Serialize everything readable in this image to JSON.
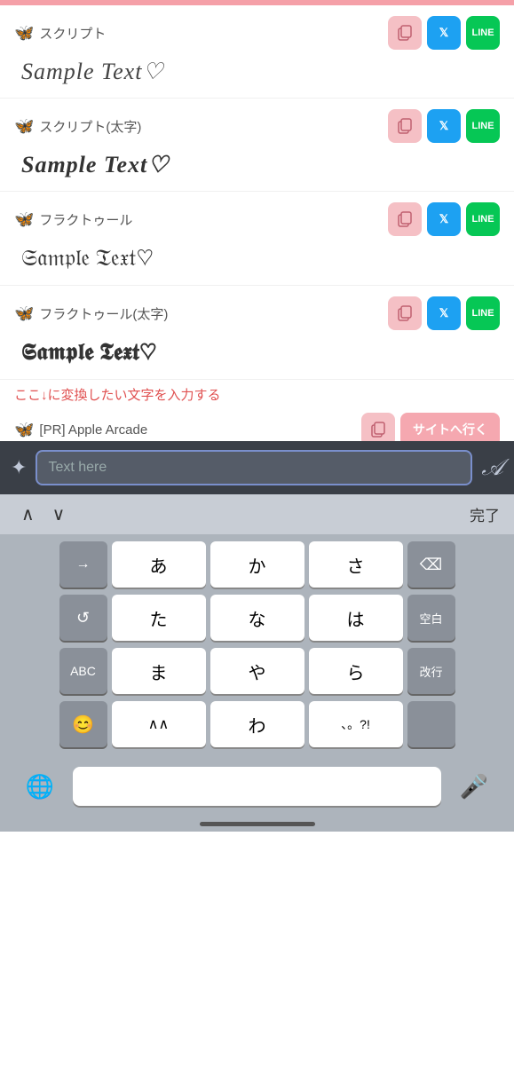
{
  "topBar": {},
  "sections": [
    {
      "id": "script",
      "label": "スクリプト",
      "sampleText": "Sample Text♡",
      "style": "script",
      "buttons": [
        "copy",
        "twitter",
        "line"
      ]
    },
    {
      "id": "script-bold",
      "label": "スクリプト(太字)",
      "sampleText": "Sample Text♡",
      "style": "script-bold",
      "buttons": [
        "copy",
        "twitter",
        "line"
      ]
    },
    {
      "id": "fraktur",
      "label": "フラクトゥール",
      "sampleText": "Sample Text♡",
      "style": "fraktur",
      "buttons": [
        "copy",
        "twitter",
        "line"
      ]
    },
    {
      "id": "fraktur-bold",
      "label": "フラクトゥール(太字)",
      "sampleText": "Sample Text♡",
      "style": "fraktur-bold",
      "buttons": [
        "copy",
        "twitter",
        "line"
      ]
    }
  ],
  "partialSection": {
    "label": "[PR] Apple Arcade",
    "buttonLabel": "サイトへ行く"
  },
  "instruction": "ここ↓に変換したい文字を入力する",
  "inputBar": {
    "placeholder": "Text here",
    "sparkleIcon": "✦",
    "fontStyleIcon": "𝒜"
  },
  "navRow": {
    "upLabel": "∧",
    "downLabel": "∨",
    "doneLabel": "完了"
  },
  "keyboard": {
    "rows": [
      [
        {
          "label": "→",
          "type": "dark",
          "id": "arrow-right"
        },
        {
          "label": "あ",
          "type": "light",
          "id": "a"
        },
        {
          "label": "か",
          "type": "light",
          "id": "ka"
        },
        {
          "label": "さ",
          "type": "light",
          "id": "sa"
        },
        {
          "label": "⌫",
          "type": "dark",
          "id": "delete"
        }
      ],
      [
        {
          "label": "↺",
          "type": "dark",
          "id": "undo"
        },
        {
          "label": "た",
          "type": "light",
          "id": "ta"
        },
        {
          "label": "な",
          "type": "light",
          "id": "na"
        },
        {
          "label": "は",
          "type": "light",
          "id": "ha"
        },
        {
          "label": "空白",
          "type": "dark",
          "id": "space-jp"
        }
      ],
      [
        {
          "label": "ABC",
          "type": "dark",
          "id": "abc"
        },
        {
          "label": "ま",
          "type": "light",
          "id": "ma"
        },
        {
          "label": "や",
          "type": "light",
          "id": "ya"
        },
        {
          "label": "ら",
          "type": "light",
          "id": "ra"
        },
        {
          "label": "改行",
          "type": "dark",
          "id": "return"
        }
      ],
      [
        {
          "label": "😊",
          "type": "dark",
          "id": "emoji"
        },
        {
          "label": "∧∧",
          "type": "light",
          "id": "dakuten"
        },
        {
          "label": "わ",
          "type": "light",
          "id": "wa"
        },
        {
          "label": "、。?!",
          "type": "light",
          "id": "punctuation"
        },
        {
          "label": "",
          "type": "dark",
          "id": "empty"
        }
      ]
    ],
    "bottomBar": {
      "globeLabel": "🌐",
      "micLabel": "🎤",
      "spaceLabel": ""
    }
  },
  "colors": {
    "topBar": "#f5a0a8",
    "inputBarBg": "#3a3f47",
    "inputFieldBg": "#555c68",
    "inputBorder": "#7a8fcc",
    "navRowBg": "#c8cdd5",
    "keyboardBg": "#adb4bc",
    "keyLight": "#ffffff",
    "keyDark": "#8a9099",
    "copyBtn": "#f5c0c5",
    "twitterBtn": "#1da1f2",
    "lineBtn": "#06c755",
    "instructionColor": "#e05050"
  }
}
